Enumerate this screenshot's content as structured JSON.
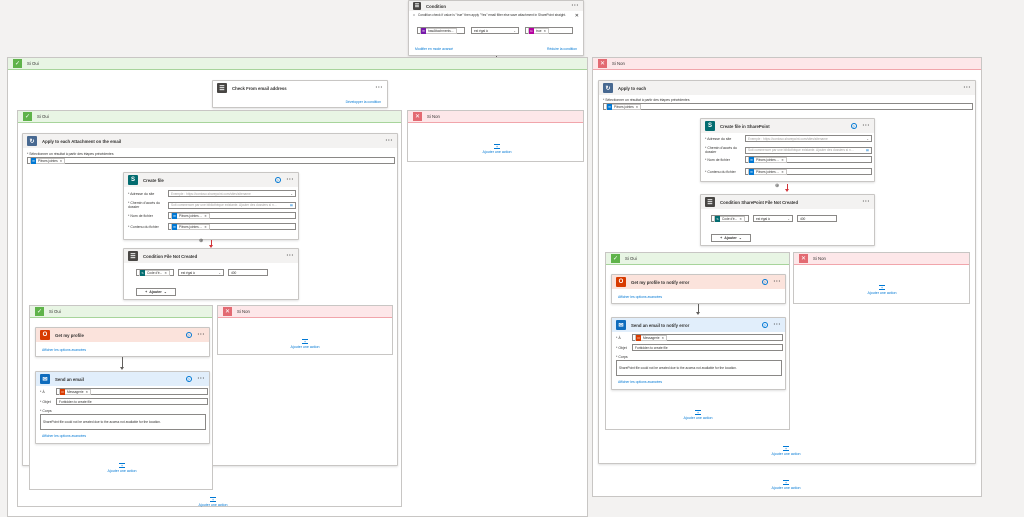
{
  "top_condition": {
    "title": "Condition",
    "description": "Condition check if value is \"true\" then apply \"Yes\" email filter else save attachment in SharePoint straight.",
    "token": "hasAttachments...",
    "operator": "est égal à",
    "value_token": "true",
    "link_left": "Modifier en mode avancé",
    "link_right": "Réduire la condition"
  },
  "left_yes": {
    "label": "Si Oui",
    "check_from": {
      "title": "Check From email address",
      "link": "Développer la condition"
    },
    "inner_yes_label": "Si Oui",
    "inner_no_label": "Si Non",
    "apply_each": {
      "title": "Apply to each Attachment on the email",
      "prompt": "* Sélectionner un résultat à partir des étapes précédentes",
      "token": "Pièces jointes"
    },
    "create_file": {
      "title": "Create file",
      "site_label": "* Adresse du site",
      "site_placeholder": "Exemple : https://contoso.sharepoint.com/sites/sitename",
      "folder_label": "* Chemin d'accès du dossier",
      "folder_placeholder": "Soit commencer par une bibliothèque existante. Ajouter des dossiers si n…",
      "name_label": "* Nom de fichier",
      "name_token": "Pièces jointes ...",
      "content_label": "* Contenu du fichier",
      "content_token": "Pièces jointes ..."
    },
    "condition_not_created": {
      "title": "Condition File Not Created",
      "token": "Code d'é...",
      "operator": "est égal à",
      "value": "400",
      "add_label": "Ajouter"
    },
    "deep_yes_label": "Si Oui",
    "deep_no_label": "Si Non",
    "get_profile": {
      "title": "Get my profile",
      "adv": "Afficher les options avancées"
    },
    "send_email": {
      "title": "Send an email",
      "to_label": "* À",
      "to_token": "Messagerie",
      "subject_label": "* Objet",
      "subject_value": "Forbidden to create file",
      "body_label": "* Corps",
      "body_value": "SharePoint file could not be created due to the access not available for the location.",
      "adv": "Afficher les options avancées"
    },
    "add_action": "Ajouter une action"
  },
  "right_no": {
    "label": "Si Non",
    "apply_each": {
      "title": "Apply to each",
      "prompt": "* Sélectionner un résultat à partir des étapes précédentes",
      "token": "Pièces jointes"
    },
    "create_file": {
      "title": "Create file in SharePoint",
      "site_label": "* Adresse du site",
      "site_placeholder": "Exemple : https://contoso.sharepoint.com/sites/sitename",
      "folder_label": "* Chemin d'accès du dossier",
      "folder_placeholder": "Soit commencer par une bibliothèque existante. Ajouter des dossiers si n…",
      "name_label": "* Nom de fichier",
      "name_token": "Pièces jointes ...",
      "content_label": "* Contenu du fichier",
      "content_token": "Pièces jointes ..."
    },
    "condition": {
      "title": "Condition SharePoint File Not Created",
      "token": "Code d'é...",
      "operator": "est égal à",
      "value": "400",
      "add_label": "Ajouter"
    },
    "inner_yes_label": "Si Oui",
    "inner_no_label": "Si Non",
    "get_profile": {
      "title": "Get my profile to notify error",
      "adv": "Afficher les options avancées"
    },
    "send_email": {
      "title": "Send an email to notify error",
      "to_label": "* À",
      "to_token": "Messagerie",
      "subject_label": "* Objet",
      "subject_value": "Forbidden to create file",
      "body_label": "* Corps",
      "body_value": "SharePoint file could not be created due to the access not available for the location.",
      "adv": "Afficher les options avancées"
    },
    "add_action": "Ajouter une action"
  },
  "colors": {
    "yes": "#5fb34a",
    "no": "#e36a72",
    "sharepoint": "#036c70",
    "outlook": "#0f6cbd",
    "office": "#d83b01",
    "control": "#484644",
    "link": "#0078d4"
  }
}
